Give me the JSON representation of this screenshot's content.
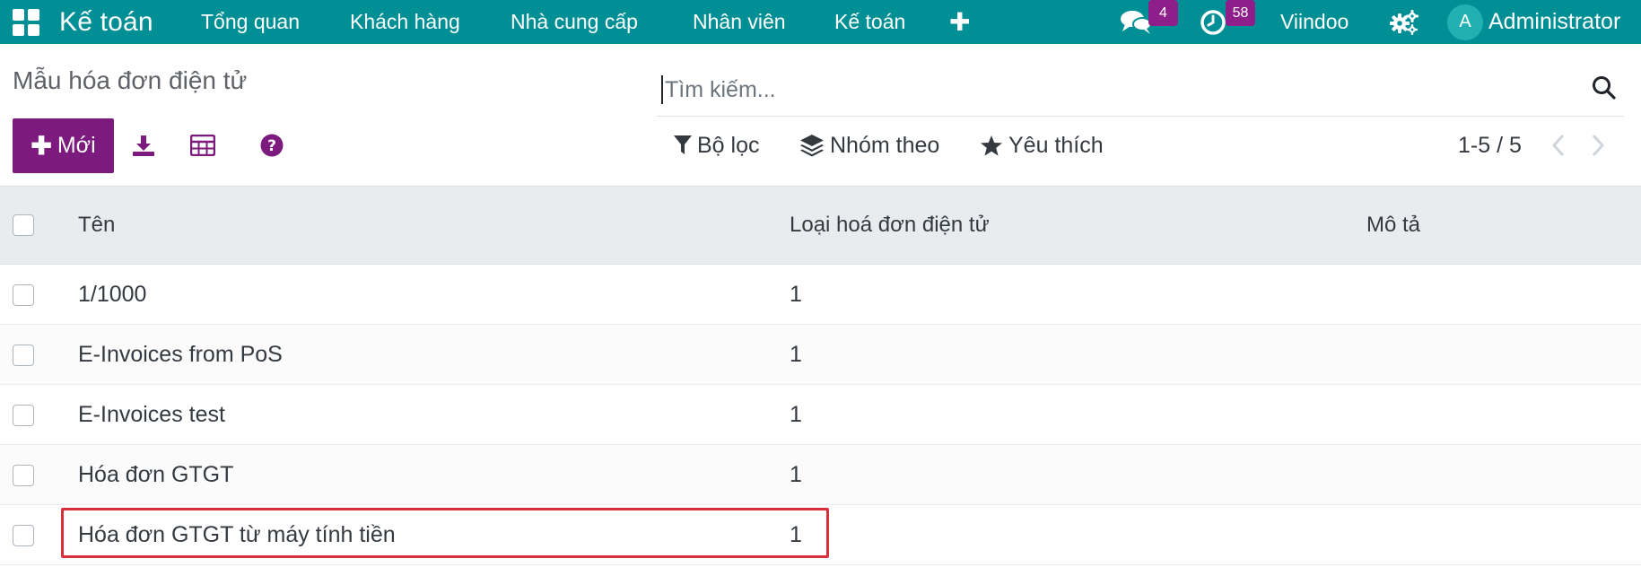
{
  "navbar": {
    "app_name": "Kế toán",
    "menu": [
      {
        "label": "Tổng quan"
      },
      {
        "label": "Khách hàng"
      },
      {
        "label": "Nhà cung cấp"
      },
      {
        "label": "Nhân viên"
      },
      {
        "label": "Kế toán"
      }
    ],
    "messages_badge": "4",
    "activities_badge": "58",
    "company": "Viindoo",
    "avatar_letter": "A",
    "user": "Administrator",
    "colors": {
      "bar": "#008f95",
      "badge": "#8e1e8a",
      "avatar": "#22b0b3"
    }
  },
  "control_panel": {
    "breadcrumb": "Mẫu hóa đơn điện tử",
    "search_placeholder": "Tìm kiếm...",
    "new_button": "Mới",
    "filter_label": "Bộ lọc",
    "group_by_label": "Nhóm theo",
    "favorites_label": "Yêu thích",
    "pager": "1-5 / 5",
    "accent_color": "#7d1a7d"
  },
  "table": {
    "columns": [
      "Tên",
      "Loại hoá đơn điện tử",
      "Mô tả"
    ],
    "rows": [
      {
        "name": "1/1000",
        "type": "1",
        "description": ""
      },
      {
        "name": "E-Invoices from PoS",
        "type": "1",
        "description": ""
      },
      {
        "name": "E-Invoices test",
        "type": "1",
        "description": ""
      },
      {
        "name": "Hóa đơn GTGT",
        "type": "1",
        "description": ""
      },
      {
        "name": "Hóa đơn GTGT từ máy tính tiền",
        "type": "1",
        "description": ""
      }
    ],
    "highlight_color": "#d8303a"
  }
}
